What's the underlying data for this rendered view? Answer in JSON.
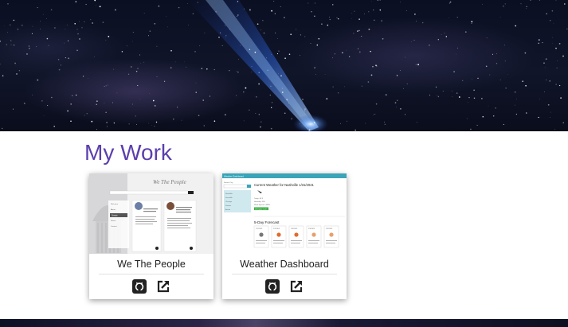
{
  "section": {
    "title": "My Work"
  },
  "projects": [
    {
      "title": "We The People",
      "thumbnail": {
        "heading": "We The People",
        "menu": [
          "Welcome",
          "About",
          "Senate",
          "House",
          "Contact"
        ]
      },
      "links": [
        {
          "icon": "github-icon",
          "label": "GitHub"
        },
        {
          "icon": "external-link-icon",
          "label": "Live site"
        }
      ]
    },
    {
      "title": "Weather Dashboard",
      "thumbnail": {
        "app_bar": "Weather Dashboard",
        "sidebar_label": "Search City",
        "current_heading": "Current Weather for Nashville 1/31/2021",
        "stats": [
          "Temp: 46°F",
          "Humidity: 65%",
          "Wind Speed: 5 MPH"
        ],
        "uv_badge": "UV Index: 1.29",
        "forecast_heading": "5-Day Forecast",
        "forecast_days": [
          "2/1/2021",
          "2/2/2021",
          "2/3/2021",
          "2/4/2021",
          "2/5/2021"
        ],
        "cities": [
          "Nashville",
          "Knoxville",
          "Chicago",
          "Denver",
          "Austin"
        ]
      },
      "links": [
        {
          "icon": "github-icon",
          "label": "GitHub"
        },
        {
          "icon": "external-link-icon",
          "label": "Live site"
        }
      ]
    }
  ],
  "colors": {
    "title": "#5b3fae",
    "weather_bar": "#3aa4b8",
    "uv_badge": "#3cb043"
  }
}
